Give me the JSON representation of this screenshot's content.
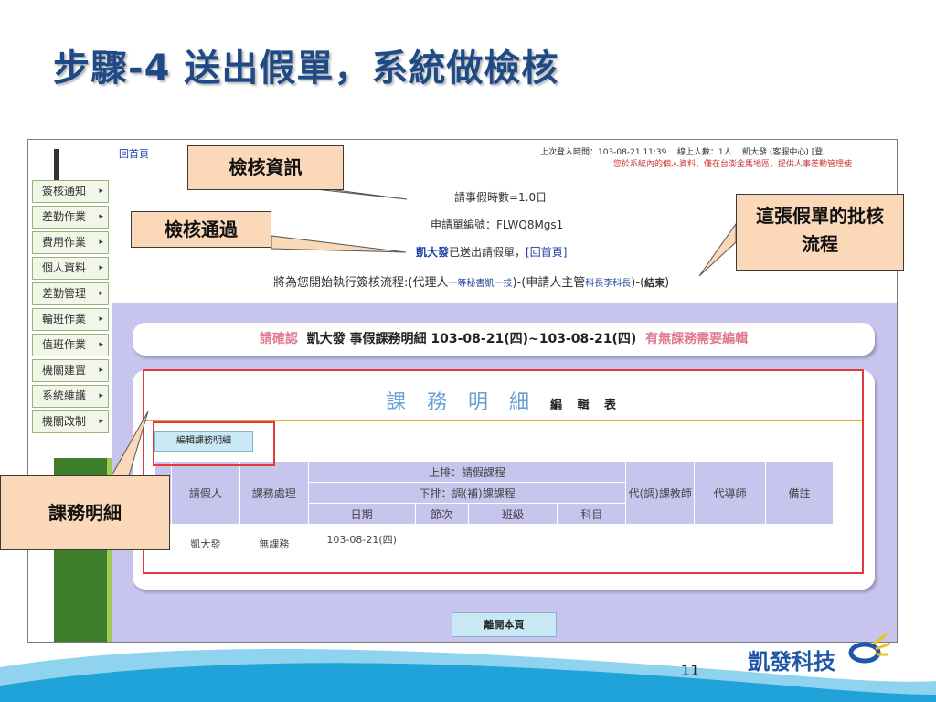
{
  "slide": {
    "title": "步驟-4  送出假單，系統做檢核",
    "page_number": "11",
    "brand": "凱發科技"
  },
  "top": {
    "home_link": "回首頁",
    "last_login": "上次登入時間：103-08-21 11:39",
    "online": "線上人數：1人",
    "user": "凱大發 (客服中心) [登",
    "privacy_notice": "您於系統內的個人資料，僅在台澎金馬地區，提供人事差勤管理使"
  },
  "sidebar": {
    "items": [
      {
        "label": "簽核通知"
      },
      {
        "label": "差勤作業"
      },
      {
        "label": "費用作業"
      },
      {
        "label": "個人資料"
      },
      {
        "label": "差勤管理"
      },
      {
        "label": "輪班作業"
      },
      {
        "label": "值班作業"
      },
      {
        "label": "機關建置"
      },
      {
        "label": "系統維護"
      },
      {
        "label": "機關改制"
      }
    ]
  },
  "check": {
    "hours": "請事假時數=1.0日",
    "form_no_label": "申請單編號：",
    "form_no": "FLWQ8Mgs1",
    "submitter": "凱大發",
    "submitted_text": "已送出請假單，",
    "home_link": "[回首頁]"
  },
  "flow": {
    "intro": "將為您開始執行簽核流程:(代理人",
    "agent": "一等秘書凱一技",
    "mid": ")-(申請人主管",
    "supervisor": "科長李科長",
    "end_open": ")-(",
    "end": "結束",
    "end_close": ")"
  },
  "confirm": {
    "prefix": "請確認",
    "main": "凱大發 事假課務明細 103-08-21(四)~103-08-21(四)",
    "suffix": "有無課務需要編輯"
  },
  "panel": {
    "title": "課 務 明 細",
    "subtitle": "編 輯 表",
    "edit_button": "編輯課務明細",
    "table": {
      "col_requester": "請假人",
      "col_handling": "課務處理",
      "upper_row": "上排：請假課程",
      "lower_row": "下排：調(補)課課程",
      "col_date": "日期",
      "col_period": "節次",
      "col_class": "班級",
      "col_subject": "科目",
      "col_substitute_teacher": "代(調)課教師",
      "col_tutor": "代導師",
      "col_note": "備註",
      "row": {
        "requester": "凱大發",
        "handling": "無課務",
        "date": "103-08-21(四)"
      }
    }
  },
  "leave_button": "離開本頁",
  "callouts": {
    "check_info": "檢核資訊",
    "check_passed": "檢核通過",
    "approval_flow": "這張假單的批核流程",
    "course_detail": "課務明細"
  }
}
